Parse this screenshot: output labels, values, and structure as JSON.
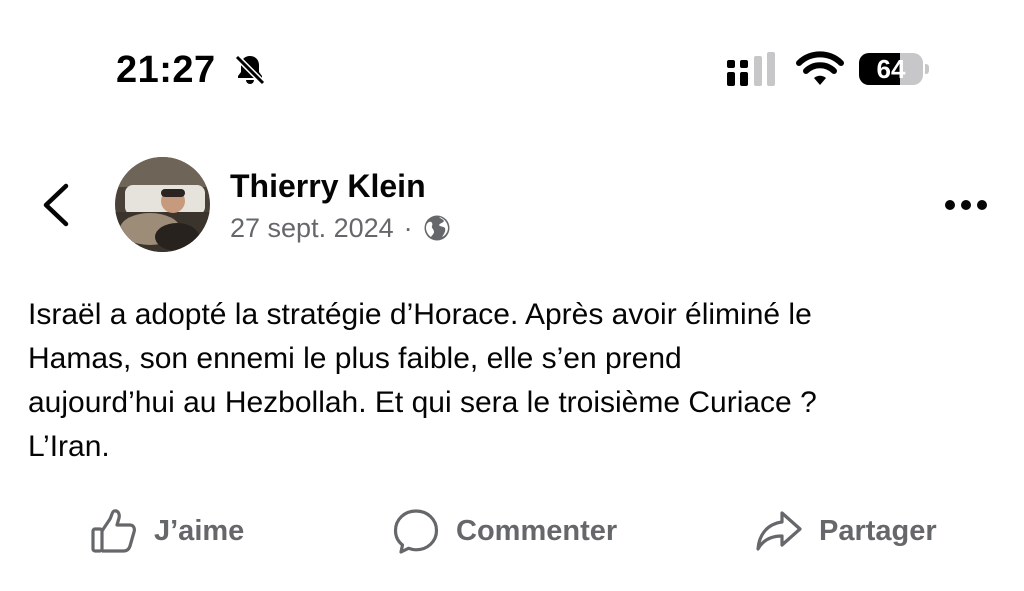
{
  "status_bar": {
    "time": "21:27",
    "battery_level": "64",
    "battery_fraction": 0.64,
    "icons": [
      "bell-slash-icon",
      "signal-icon",
      "wifi-icon",
      "battery-icon"
    ]
  },
  "post": {
    "author": "Thierry Klein",
    "date": "27 sept. 2024",
    "separator": "·",
    "privacy_icon": "globe-icon",
    "text_lines": [
      "Israël a adopté la stratégie d’Horace. Après avoir éliminé le",
      "Hamas, son ennemi le plus faible, elle s’en prend",
      "aujourd’hui au Hezbollah. Et qui sera le troisième Curiace ?",
      "L’Iran."
    ]
  },
  "actions": {
    "like": "J’aime",
    "comment": "Commenter",
    "share": "Partager"
  },
  "colors": {
    "text": "#050505",
    "secondary": "#65676b",
    "background": "#ffffff"
  }
}
